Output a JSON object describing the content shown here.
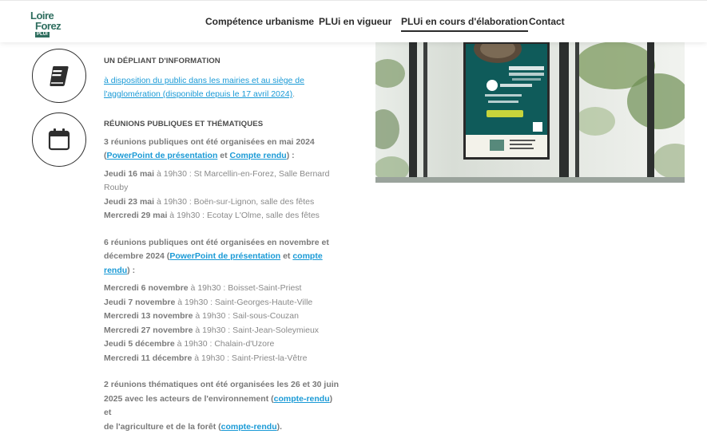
{
  "header": {
    "logo": {
      "line1": "Loire",
      "line2": "Forez",
      "line3": "PLUI"
    },
    "nav": [
      {
        "label": "Compétence urbanisme"
      },
      {
        "label": "PLUi en vigueur"
      },
      {
        "label": "PLUi en cours d'élaboration"
      },
      {
        "label": "Contact"
      }
    ]
  },
  "sections": {
    "depliant": {
      "heading": "UN DÉPLIANT D'INFORMATION",
      "link_line1": "à disposition du public dans les mairies et au siège de",
      "link_line2": "l'agglomération (disponible depuis le 17 avril 2024)",
      "link_end": "."
    },
    "reunions": {
      "heading": "RÉUNIONS PUBLIQUES ET THÉMATIQUES",
      "group1": {
        "intro": "3 réunions publiques ont été organisées en mai 2024",
        "open": "(",
        "link1": "PowerPoint de présentation",
        "and": " et ",
        "link2": "Compte rendu",
        "close": ") :",
        "items": [
          {
            "day": "Jeudi 16 mai",
            "rest": " à 19h30 : St Marcellin-en-Forez, Salle Bernard Rouby"
          },
          {
            "day": "Jeudi 23 mai",
            "rest": " à 19h30 : Boën-sur-Lignon, salle des fêtes"
          },
          {
            "day": "Mercredi 29 mai",
            "rest": " à 19h30 : Ecotay L'Olme, salle des fêtes"
          }
        ]
      },
      "group2": {
        "intro_a": "6 réunions publiques ont été organisées en novembre et",
        "intro_b": "décembre 2024 (",
        "link1": "PowerPoint de présentation",
        "and": " et ",
        "link2a": "compte",
        "link2b": "rendu",
        "close": ") :",
        "items": [
          {
            "day": "Mercredi 6 novembre",
            "rest": " à 19h30 : Boisset-Saint-Priest"
          },
          {
            "day": "Jeudi 7 novembre",
            "rest": " à 19h30 : Saint-Georges-Haute-Ville"
          },
          {
            "day": "Mercredi 13 novembre",
            "rest": " à 19h30 : Sail-sous-Couzan"
          },
          {
            "day": "Mercredi 27 novembre",
            "rest": " à 19h30 : Saint-Jean-Soleymieux"
          },
          {
            "day": "Jeudi 5 décembre",
            "rest": " à 19h30 : Chalain-d'Uzore"
          },
          {
            "day": "Mercredi 11 décembre",
            "rest": " à 19h30 : Saint-Priest-la-Vêtre"
          }
        ]
      },
      "group3": {
        "line1": "2 réunions thématiques ont été organisées les 26 et 30 juin",
        "line2_pre": "2025 avec les acteurs de l'environnement (",
        "link1": "compte-rendu",
        "line2_post": ") et",
        "line3_pre": "de l'agriculture et de la forêt (",
        "link2": "compte-rendu",
        "line3_post": ")."
      }
    }
  },
  "colors": {
    "link": "#1a9ad6",
    "brand": "#2f6e5f"
  },
  "icons": [
    "booklet-icon",
    "calendar-icon"
  ]
}
